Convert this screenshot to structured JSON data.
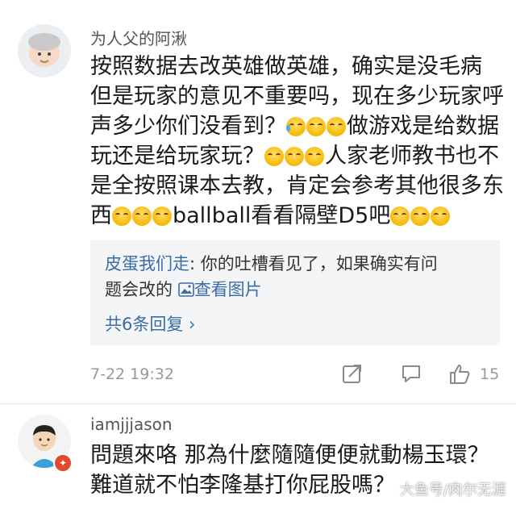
{
  "comments": [
    {
      "username": "为人父的阿湫",
      "lines": [
        [
          "按照数据去改英雄做英雄，确实是没毛病"
        ],
        [
          "但是玩家的意见不重要吗，现在多少玩家呼"
        ],
        [
          "声多少你们没看到？",
          "做游戏是给数据"
        ],
        [
          "玩还是给玩家玩？",
          "人家老师教书也不"
        ],
        [
          "是全按照课本去教，肯定会参考其他很多东"
        ],
        [
          "西",
          "ballball看看隔壁D5吧"
        ]
      ],
      "emoji_name": "tears-of-joy-emoji",
      "reply": {
        "author": "皮蛋我们走",
        "separator": ": ",
        "text_line1": "你的吐槽看见了，如果确实有问",
        "text_line2": "题会改的",
        "image_link": "查看图片"
      },
      "more_replies": "共6条回复 ›",
      "timestamp": "7-22 19:32",
      "likes": "15"
    },
    {
      "username": "iamjjjason",
      "line1": "問題來咯 那為什麼隨隨便便就動楊玉環？",
      "line2": "難道就不怕李隆基打你屁股嗎？"
    }
  ],
  "watermark": "大鱼号/肉尔无涯"
}
